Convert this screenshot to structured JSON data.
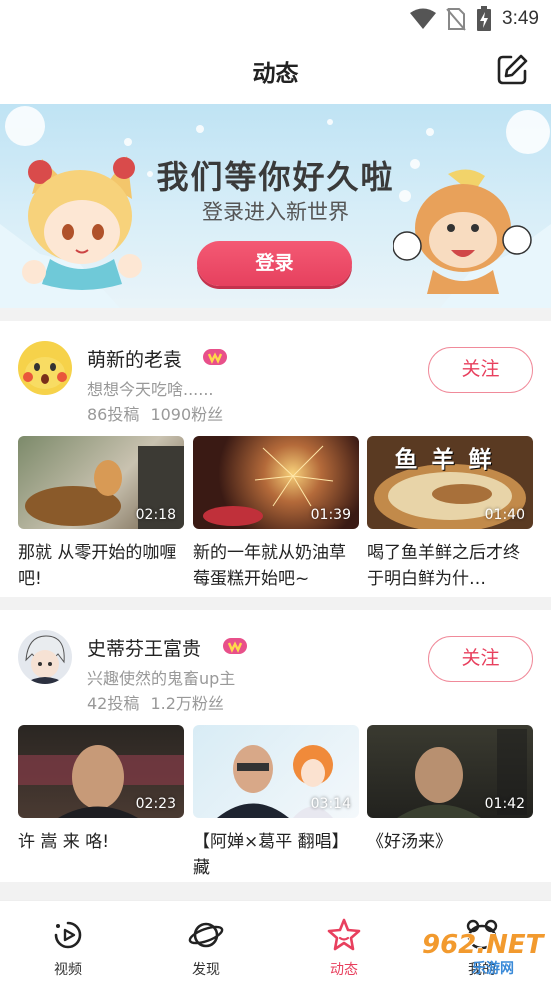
{
  "status_bar": {
    "time": "3:49",
    "icons": [
      "wifi-icon",
      "no-sim-icon",
      "battery-charging-icon"
    ]
  },
  "header": {
    "title": "动态",
    "edit_icon": "edit-icon"
  },
  "banner": {
    "title": "我们等你好久啦",
    "subtitle": "登录进入新世界",
    "login_label": "登录"
  },
  "feed": [
    {
      "name": "萌新的老袁",
      "desc": "想想今天吃啥......",
      "stats": "86投稿 1090粉丝",
      "follow_label": "关注",
      "videos": [
        {
          "duration": "02:18",
          "title": "那就 从零开始的咖喱吧!"
        },
        {
          "duration": "01:39",
          "title": "新的一年就从奶油草莓蛋糕开始吧~"
        },
        {
          "duration": "01:40",
          "title": "喝了鱼羊鲜之后才终于明白鲜为什…",
          "thumb_text": "鱼羊鲜"
        }
      ]
    },
    {
      "name": "史蒂芬王富贵",
      "desc": "兴趣使然的鬼畜up主",
      "stats": "42投稿 1.2万粉丝",
      "follow_label": "关注",
      "videos": [
        {
          "duration": "02:23",
          "title": "许 嵩 来 咯!"
        },
        {
          "duration": "03:14",
          "title": "【阿婵×葛平 翻唱】藏"
        },
        {
          "duration": "01:42",
          "title": "《好汤来》"
        }
      ]
    }
  ],
  "bottom_nav": [
    {
      "label": "视频",
      "icon": "video-icon",
      "active": false
    },
    {
      "label": "发现",
      "icon": "planet-icon",
      "active": false
    },
    {
      "label": "动态",
      "icon": "star-icon",
      "active": true
    },
    {
      "label": "我的",
      "icon": "profile-icon",
      "active": false
    }
  ],
  "watermark": {
    "text": "962.NET",
    "subtext": "乐游网"
  },
  "colors": {
    "accent": "#e8405e",
    "banner_bg": "#cfe9f5",
    "muted_text": "#999999"
  }
}
